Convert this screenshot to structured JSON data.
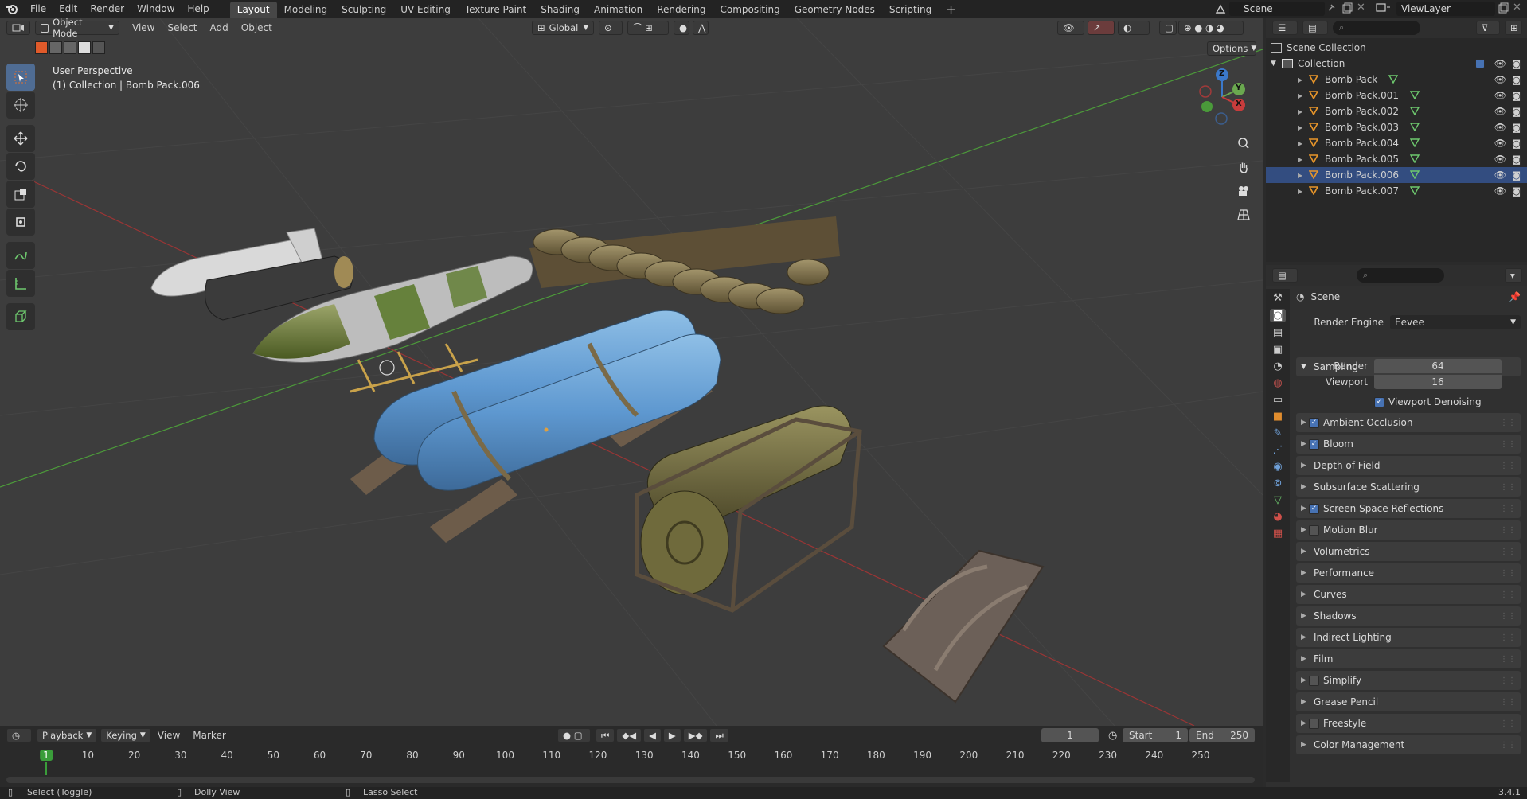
{
  "topbar": {
    "menus": [
      "File",
      "Edit",
      "Render",
      "Window",
      "Help"
    ],
    "workspaces": [
      "Layout",
      "Modeling",
      "Sculpting",
      "UV Editing",
      "Texture Paint",
      "Shading",
      "Animation",
      "Rendering",
      "Compositing",
      "Geometry Nodes",
      "Scripting"
    ],
    "active_workspace": "Layout",
    "scene_name": "Scene",
    "view_layer": "ViewLayer"
  },
  "viewport": {
    "mode": "Object Mode",
    "menus": [
      "View",
      "Select",
      "Add",
      "Object"
    ],
    "transform_orientation": "Global",
    "options_label": "Options",
    "perspective_label": "User Perspective",
    "collection_label": "(1) Collection | Bomb Pack.006",
    "gizmo_axes": {
      "x": "X",
      "y": "Y",
      "z": "Z"
    }
  },
  "outliner": {
    "root": "Scene Collection",
    "collection": "Collection",
    "items": [
      "Bomb Pack",
      "Bomb Pack.001",
      "Bomb Pack.002",
      "Bomb Pack.003",
      "Bomb Pack.004",
      "Bomb Pack.005",
      "Bomb Pack.006",
      "Bomb Pack.007"
    ],
    "selected": "Bomb Pack.006"
  },
  "properties": {
    "context": "Scene",
    "render_engine_label": "Render Engine",
    "render_engine": "Eevee",
    "sampling_title": "Sampling",
    "render_label": "Render",
    "render_value": "64",
    "viewport_label": "Viewport",
    "viewport_value": "16",
    "viewport_denoising": "Viewport Denoising",
    "panels": [
      {
        "label": "Ambient Occlusion",
        "checkbox": true,
        "checked": true
      },
      {
        "label": "Bloom",
        "checkbox": true,
        "checked": true
      },
      {
        "label": "Depth of Field",
        "checkbox": false
      },
      {
        "label": "Subsurface Scattering",
        "checkbox": false
      },
      {
        "label": "Screen Space Reflections",
        "checkbox": true,
        "checked": true
      },
      {
        "label": "Motion Blur",
        "checkbox": true,
        "checked": false
      },
      {
        "label": "Volumetrics",
        "checkbox": false
      },
      {
        "label": "Performance",
        "checkbox": false
      },
      {
        "label": "Curves",
        "checkbox": false
      },
      {
        "label": "Shadows",
        "checkbox": false
      },
      {
        "label": "Indirect Lighting",
        "checkbox": false
      },
      {
        "label": "Film",
        "checkbox": false
      },
      {
        "label": "Simplify",
        "checkbox": true,
        "checked": false
      },
      {
        "label": "Grease Pencil",
        "checkbox": false
      },
      {
        "label": "Freestyle",
        "checkbox": true,
        "checked": false
      },
      {
        "label": "Color Management",
        "checkbox": false
      }
    ]
  },
  "timeline": {
    "menus": [
      "Playback",
      "Keying",
      "View",
      "Marker"
    ],
    "current_frame": "1",
    "start_label": "Start",
    "start": "1",
    "end_label": "End",
    "end": "250",
    "ticks": [
      "1",
      "10",
      "20",
      "30",
      "40",
      "50",
      "60",
      "70",
      "80",
      "90",
      "100",
      "110",
      "120",
      "130",
      "140",
      "150",
      "160",
      "170",
      "180",
      "190",
      "200",
      "210",
      "220",
      "230",
      "240",
      "250"
    ]
  },
  "statusbar": {
    "select": "Select (Toggle)",
    "dolly": "Dolly View",
    "lasso": "Lasso Select",
    "version": "3.4.1"
  },
  "colors": {
    "accent": "#4772b3",
    "selected_row": "#334d80",
    "axis_x": "#c83c3c",
    "axis_y": "#4c9a3a",
    "frame_marker": "#3a9d3a"
  }
}
